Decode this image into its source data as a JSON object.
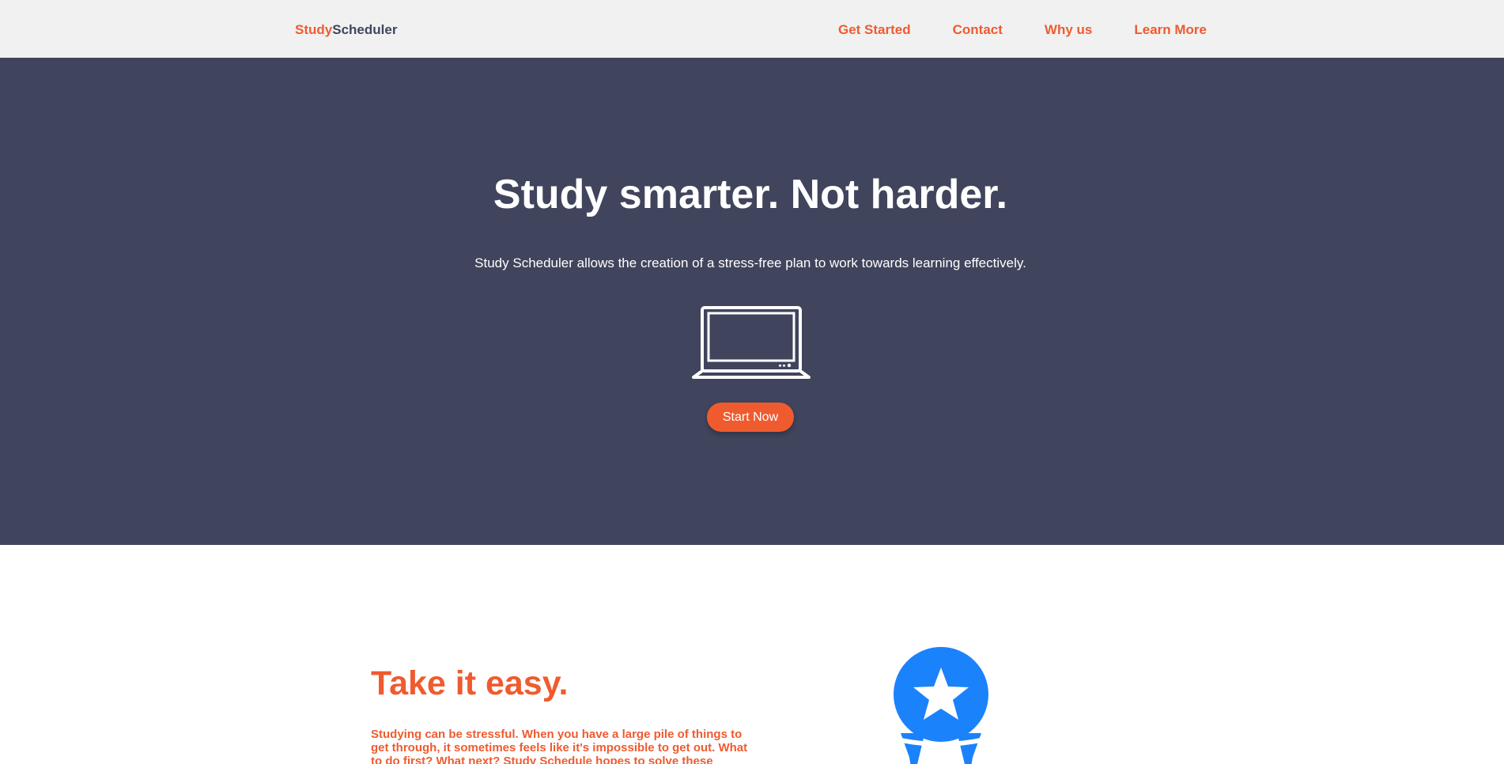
{
  "navbar": {
    "brand_part1": "Study",
    "brand_part2": "Scheduler",
    "links": [
      {
        "label": "Get Started"
      },
      {
        "label": "Contact"
      },
      {
        "label": "Why us"
      },
      {
        "label": "Learn More"
      }
    ]
  },
  "hero": {
    "title": "Study smarter. Not harder.",
    "subtitle": "Study Scheduler allows the creation of a stress-free plan to work towards learning effectively.",
    "icon": "laptop-icon",
    "button_label": "Start Now"
  },
  "feature": {
    "title": "Take it easy.",
    "text": "Studying can be stressful. When you have a large pile of things to get through, it sometimes feels like it's impossible to get out. What to do first? What next? Study Schedule hopes to solve these problems.",
    "icon": "award-ribbon-icon"
  },
  "colors": {
    "accent": "#ef5b2f",
    "hero_background": "#40445c",
    "navbar_background": "#f1f1f1",
    "award_blue": "#1a82fb"
  }
}
